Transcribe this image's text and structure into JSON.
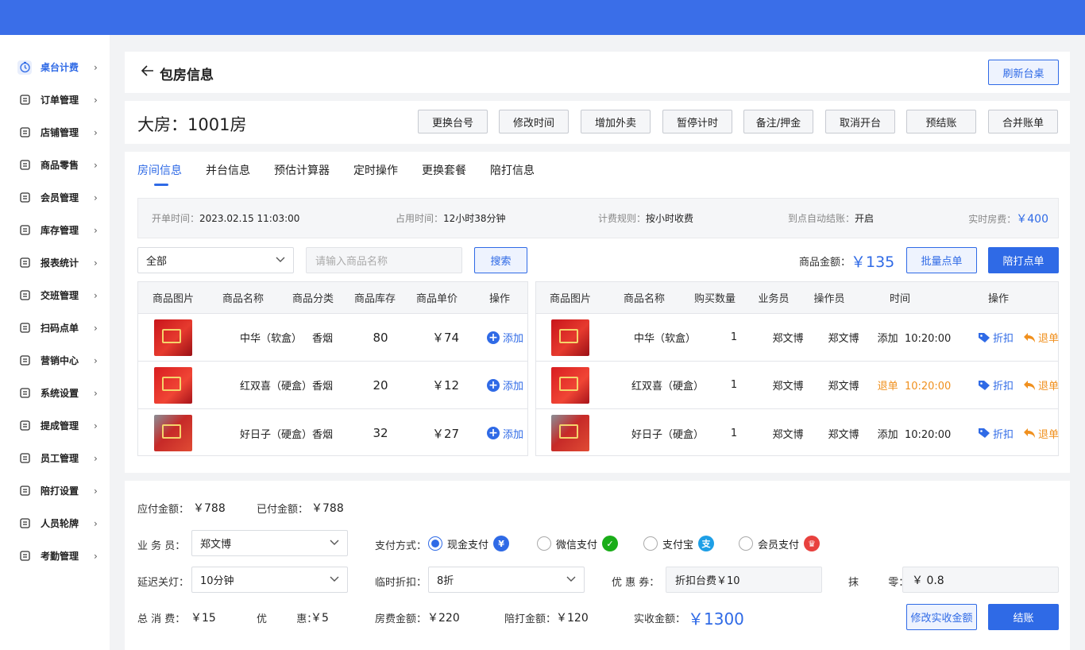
{
  "sidebar": {
    "items": [
      {
        "label": "桌台计费",
        "icon": "timer-icon",
        "active": true
      },
      {
        "label": "订单管理",
        "icon": "order-icon"
      },
      {
        "label": "店铺管理",
        "icon": "store-icon"
      },
      {
        "label": "商品零售",
        "icon": "shopping-bag-icon"
      },
      {
        "label": "会员管理",
        "icon": "member-icon"
      },
      {
        "label": "库存管理",
        "icon": "warehouse-icon"
      },
      {
        "label": "报表统计",
        "icon": "report-icon"
      },
      {
        "label": "交班管理",
        "icon": "handover-icon"
      },
      {
        "label": "扫码点单",
        "icon": "scan-icon"
      },
      {
        "label": "营销中心",
        "icon": "marketing-icon"
      },
      {
        "label": "系统设置",
        "icon": "settings-icon"
      },
      {
        "label": "提成管理",
        "icon": "commission-icon"
      },
      {
        "label": "员工管理",
        "icon": "staff-icon"
      },
      {
        "label": "陪打设置",
        "icon": "headset-icon"
      },
      {
        "label": "人员轮牌",
        "icon": "rotation-icon"
      },
      {
        "label": "考勤管理",
        "icon": "attendance-icon"
      }
    ]
  },
  "header": {
    "back_icon": "arrow-left-icon",
    "title": "包房信息",
    "refresh_label": "刷新台桌"
  },
  "room": {
    "title": "大房：1001房",
    "actions": [
      "更换台号",
      "修改时间",
      "增加外卖",
      "暂停计时",
      "备注/押金",
      "取消开台",
      "预结账",
      "合并账单"
    ]
  },
  "tabs": [
    "房间信息",
    "并台信息",
    "预估计算器",
    "定时操作",
    "更换套餐",
    "陪打信息"
  ],
  "info": {
    "open_time_k": "开单时间：",
    "open_time_v": "2023.02.15  11:03:00",
    "use_time_k": "占用时间：",
    "use_time_v": "12小时38分钟",
    "rule_k": "计费规则：",
    "rule_v": "按小时收费",
    "auto_k": "到点自动结账：",
    "auto_v": "开启",
    "fee_k": "实时房费：",
    "fee_v": "￥400"
  },
  "filter": {
    "category": "全部",
    "search_placeholder": "请输入商品名称",
    "search_label": "搜索",
    "amount_k": "商品金额：",
    "amount_v": "￥135",
    "batch_label": "批量点单",
    "accompany_label": "陪打点单"
  },
  "left_table": {
    "headers": [
      "商品图片",
      "商品名称",
      "商品分类",
      "商品库存",
      "商品单价",
      "操作"
    ],
    "rows": [
      {
        "name": "中华（软盒）",
        "cat": "香烟",
        "stock": "80",
        "price": "￥74",
        "op": "添加"
      },
      {
        "name": "红双喜（硬盒）",
        "cat": "香烟",
        "stock": "20",
        "price": "￥12",
        "op": "添加"
      },
      {
        "name": "好日子（硬盒）",
        "cat": "香烟",
        "stock": "32",
        "price": "￥27",
        "op": "添加"
      }
    ]
  },
  "right_table": {
    "headers": [
      "商品图片",
      "商品名称",
      "购买数量",
      "业务员",
      "操作员",
      "时间",
      "操作"
    ],
    "rows": [
      {
        "name": "中华（软盒）",
        "qty": "1",
        "sales": "郑文博",
        "operator": "郑文博",
        "type": "添加",
        "time": "10:20:00",
        "discount": "折扣",
        "refund": "退单",
        "refunded": false
      },
      {
        "name": "红双喜（硬盒）",
        "qty": "1",
        "sales": "郑文博",
        "operator": "郑文博",
        "type": "退单",
        "time": "10:20:00",
        "discount": "折扣",
        "refund": "退单",
        "refunded": true
      },
      {
        "name": "好日子（硬盒）",
        "qty": "1",
        "sales": "郑文博",
        "operator": "郑文博",
        "type": "添加",
        "time": "10:20:00",
        "discount": "折扣",
        "refund": "退单",
        "refunded": false
      }
    ]
  },
  "checkout": {
    "due_k": "应付金额：",
    "due_v": "￥788",
    "paid_k": "已付金额：",
    "paid_v": "￥788",
    "sales_k": "业 务 员：",
    "sales_v": "郑文博",
    "pay_k": "支付方式：",
    "pay_methods": [
      {
        "label": "现金支付",
        "selected": true,
        "icon": "cash-icon",
        "color": "#2f6ae6"
      },
      {
        "label": "微信支付",
        "selected": false,
        "icon": "wechat-icon",
        "color": "#1aad19"
      },
      {
        "label": "支付宝",
        "selected": false,
        "icon": "alipay-icon",
        "color": "#1e9fe6"
      },
      {
        "label": "会员支付",
        "selected": false,
        "icon": "crown-icon",
        "color": "#e8413e"
      }
    ],
    "light_k": "延迟关灯：",
    "light_v": "10分钟",
    "discount_k": "临时折扣：",
    "discount_v": "8折",
    "coupon_k": "优 惠 券：",
    "coupon_v": "折扣台费￥10",
    "round_k": "抹         零：",
    "round_v": "￥ 0.8",
    "total_k": "总 消 费：",
    "total_v": "￥15",
    "promo_k": "优         惠：",
    "promo_v": "￥5",
    "room_fee_k": "房费金额：",
    "room_fee_v": "￥220",
    "acc_fee_k": "陪打金额：",
    "acc_fee_v": "￥120",
    "actual_k": "实收金额：",
    "actual_v": "￥1300",
    "modify_label": "修改实收金额",
    "settle_label": "结账"
  },
  "colors": {
    "primary": "#2f6ae6",
    "topbar": "#3a6ee8",
    "warning": "#f0901e"
  }
}
